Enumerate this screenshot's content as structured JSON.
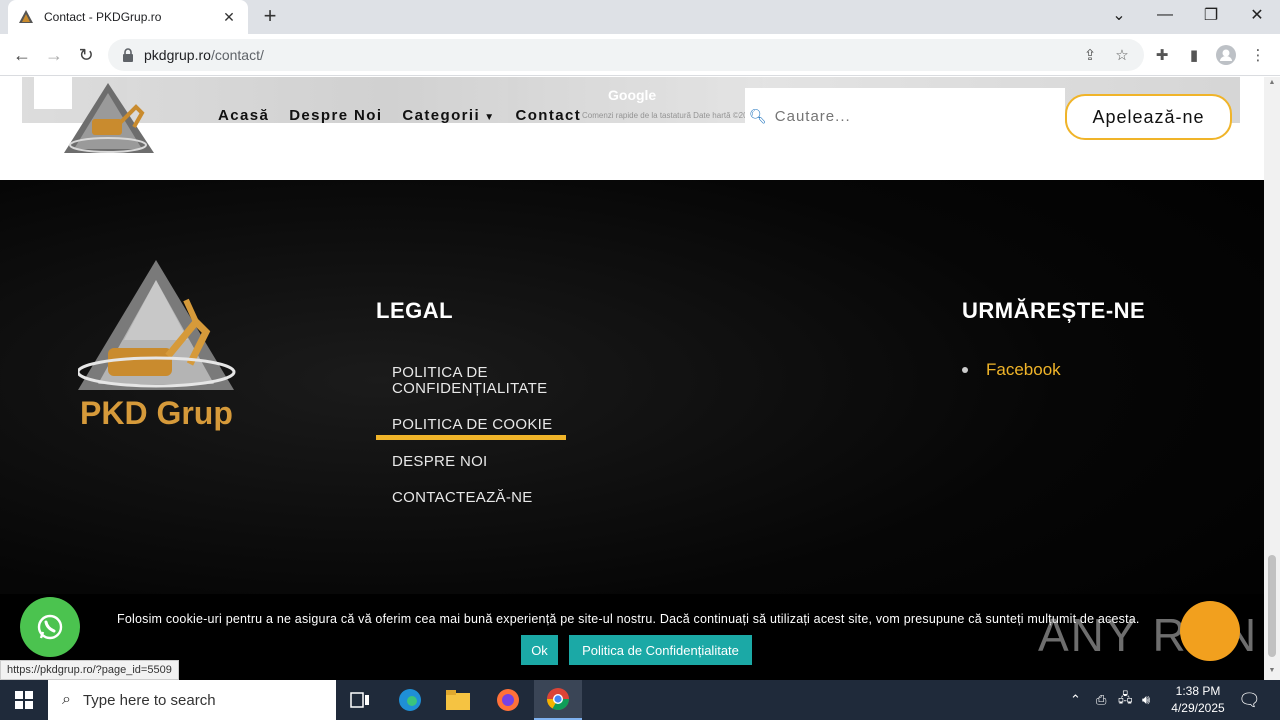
{
  "browser": {
    "tab_title": "Contact - PKDGrup.ro",
    "url_host": "pkdgrup.ro",
    "url_path": "/contact/",
    "status_url": "https://pkdgrup.ro/?page_id=5509"
  },
  "header": {
    "map_brand": "Google",
    "map_attribution": "Comenzi rapide de la tastatură   Date hartă ©2025",
    "nav": [
      "Acasă",
      "Despre Noi",
      "Categorii",
      "Contact"
    ],
    "search_placeholder": "Cautare...",
    "call_button": "Apelează-ne"
  },
  "footer": {
    "logo_text": "PKD Grup",
    "legal_heading": "LEGAL",
    "legal_links": [
      "POLITICA DE CONFIDENȚIALITATE",
      "POLITICA DE COOKIE",
      "DESPRE NOI",
      "CONTACTEAZĂ-NE"
    ],
    "follow_heading": "URMĂREȘTE-NE",
    "follow_links": [
      "Facebook"
    ]
  },
  "cookie": {
    "text": "Folosim cookie-uri pentru a ne asigura că vă oferim cea mai bună experiență pe site-ul nostru. Dacă continuați să utilizați acest site, vom presupune că sunteți mulțumit de acesta.",
    "ok": "Ok",
    "policy": "Politica de Confidențialitate"
  },
  "watermark": "ANY RUN",
  "taskbar": {
    "search_placeholder": "Type here to search",
    "time": "1:38 PM",
    "date": "4/29/2025"
  },
  "colors": {
    "accent": "#f0b429",
    "cookie_button": "#1ba9a6",
    "whatsapp": "#4bc34f",
    "chat": "#f2a01e"
  }
}
